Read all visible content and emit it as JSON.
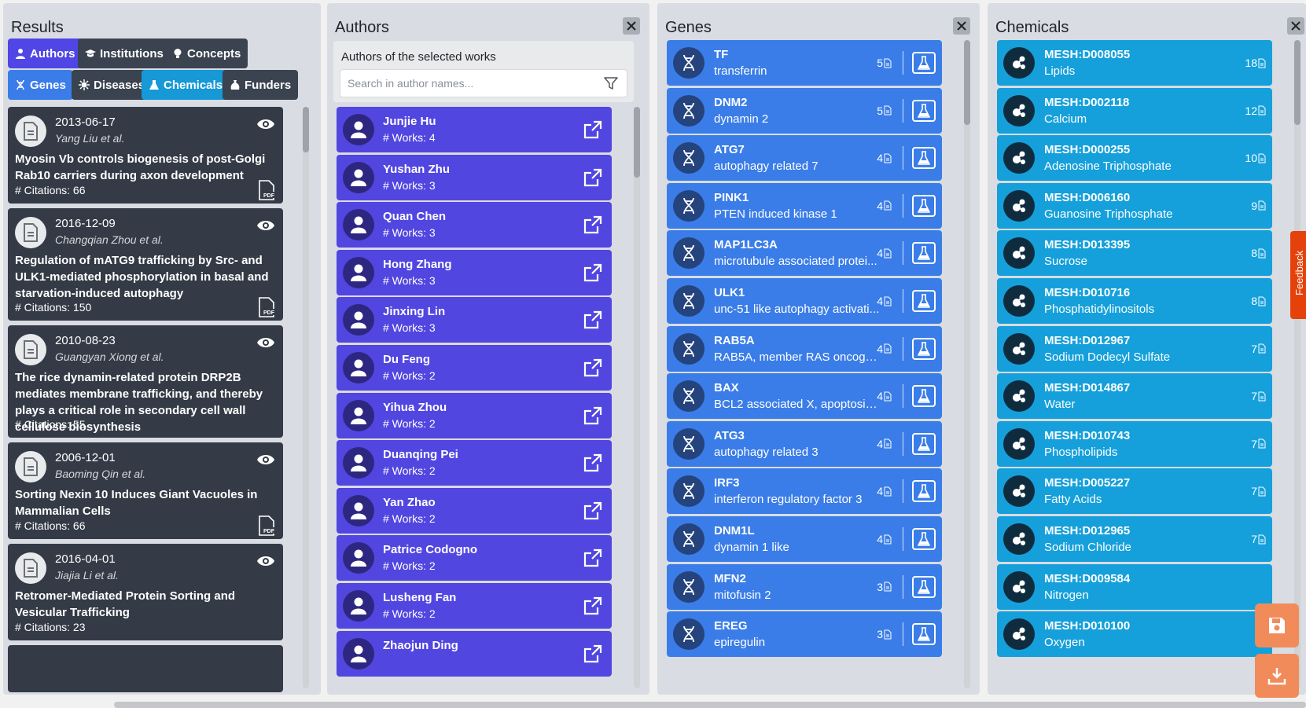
{
  "results": {
    "title": "Results",
    "buttons": [
      {
        "label": "Authors",
        "icon": "user-icon",
        "color": "#4f46e5"
      },
      {
        "label": "Institutions",
        "icon": "graduation-cap-icon",
        "color": "#3b4350"
      },
      {
        "label": "Concepts",
        "icon": "lightbulb-icon",
        "color": "#3b4350"
      },
      {
        "label": "Genes",
        "icon": "dna-icon",
        "color": "#3b7de8"
      },
      {
        "label": "Diseases",
        "icon": "virus-icon",
        "color": "#3b4350"
      },
      {
        "label": "Chemicals",
        "icon": "flask-icon",
        "color": "#1699d6"
      },
      {
        "label": "Funders",
        "icon": "money-bag-icon",
        "color": "#3b4350"
      }
    ],
    "works": [
      {
        "date": "2013-06-17",
        "authors": "Yang Liu et al.",
        "title": "Myosin Vb controls biogenesis of post-Golgi Rab10 carriers during axon development",
        "citations": "# Citations: 66",
        "pdf": true
      },
      {
        "date": "2016-12-09",
        "authors": "Changqian Zhou et al.",
        "title": "Regulation of mATG9 trafficking by Src- and ULK1-mediated phosphorylation in basal and starvation-induced autophagy",
        "citations": "# Citations: 150",
        "pdf": true
      },
      {
        "date": "2010-08-23",
        "authors": "Guangyan Xiong et al.",
        "title": "The rice dynamin-related protein DRP2B mediates membrane trafficking, and thereby plays a critical role in secondary cell wall cellulose biosynthesis",
        "citations": "# Citations: 55",
        "pdf": false
      },
      {
        "date": "2006-12-01",
        "authors": "Baoming Qin et al.",
        "title": "Sorting Nexin 10 Induces Giant Vacuoles in Mammalian Cells",
        "citations": "# Citations: 66",
        "pdf": true
      },
      {
        "date": "2016-04-01",
        "authors": "Jiajia Li et al.",
        "title": "Retromer-Mediated Protein Sorting and Vesicular Trafficking",
        "citations": "# Citations: 23",
        "pdf": false
      }
    ]
  },
  "authors_panel": {
    "title": "Authors",
    "subtitle": "Authors of the selected works",
    "search_placeholder": "Search in author names...",
    "items": [
      {
        "name": "Junjie Hu",
        "works": "# Works: 4"
      },
      {
        "name": "Yushan Zhu",
        "works": "# Works: 3"
      },
      {
        "name": "Quan Chen",
        "works": "# Works: 3"
      },
      {
        "name": "Hong Zhang",
        "works": "# Works: 3"
      },
      {
        "name": "Jinxing Lin",
        "works": "# Works: 3"
      },
      {
        "name": "Du Feng",
        "works": "# Works: 2"
      },
      {
        "name": "Yihua Zhou",
        "works": "# Works: 2"
      },
      {
        "name": "Duanqing Pei",
        "works": "# Works: 2"
      },
      {
        "name": "Yan Zhao",
        "works": "# Works: 2"
      },
      {
        "name": "Patrice Codogno",
        "works": "# Works: 2"
      },
      {
        "name": "Lusheng Fan",
        "works": "# Works: 2"
      },
      {
        "name": "Zhaojun Ding",
        "works": ""
      }
    ]
  },
  "genes_panel": {
    "title": "Genes",
    "items": [
      {
        "code": "TF",
        "name": "transferrin",
        "count": "5"
      },
      {
        "code": "DNM2",
        "name": "dynamin 2",
        "count": "5"
      },
      {
        "code": "ATG7",
        "name": "autophagy related 7",
        "count": "4"
      },
      {
        "code": "PINK1",
        "name": "PTEN induced kinase 1",
        "count": "4"
      },
      {
        "code": "MAP1LC3A",
        "name": "microtubule associated protei...",
        "count": "4"
      },
      {
        "code": "ULK1",
        "name": "unc-51 like autophagy activati...",
        "count": "4"
      },
      {
        "code": "RAB5A",
        "name": "RAB5A, member RAS oncogen...",
        "count": "4"
      },
      {
        "code": "BAX",
        "name": "BCL2 associated X, apoptosis r...",
        "count": "4"
      },
      {
        "code": "ATG3",
        "name": "autophagy related 3",
        "count": "4"
      },
      {
        "code": "IRF3",
        "name": "interferon regulatory factor 3",
        "count": "4"
      },
      {
        "code": "DNM1L",
        "name": "dynamin 1 like",
        "count": "4"
      },
      {
        "code": "MFN2",
        "name": "mitofusin 2",
        "count": "3"
      },
      {
        "code": "EREG",
        "name": "epiregulin",
        "count": "3"
      }
    ]
  },
  "chemicals_panel": {
    "title": "Chemicals",
    "items": [
      {
        "code": "MESH:D008055",
        "name": "Lipids",
        "count": "18"
      },
      {
        "code": "MESH:D002118",
        "name": "Calcium",
        "count": "12"
      },
      {
        "code": "MESH:D000255",
        "name": "Adenosine Triphosphate",
        "count": "10"
      },
      {
        "code": "MESH:D006160",
        "name": "Guanosine Triphosphate",
        "count": "9"
      },
      {
        "code": "MESH:D013395",
        "name": "Sucrose",
        "count": "8"
      },
      {
        "code": "MESH:D010716",
        "name": "Phosphatidylinositols",
        "count": "8"
      },
      {
        "code": "MESH:D012967",
        "name": "Sodium Dodecyl Sulfate",
        "count": "7"
      },
      {
        "code": "MESH:D014867",
        "name": "Water",
        "count": "7"
      },
      {
        "code": "MESH:D010743",
        "name": "Phospholipids",
        "count": "7"
      },
      {
        "code": "MESH:D005227",
        "name": "Fatty Acids",
        "count": "7"
      },
      {
        "code": "MESH:D012965",
        "name": "Sodium Chloride",
        "count": "7"
      },
      {
        "code": "MESH:D009584",
        "name": "Nitrogen",
        "count": ""
      },
      {
        "code": "MESH:D010100",
        "name": "Oxygen",
        "count": ""
      }
    ]
  },
  "feedback": {
    "label": "Feedback"
  }
}
